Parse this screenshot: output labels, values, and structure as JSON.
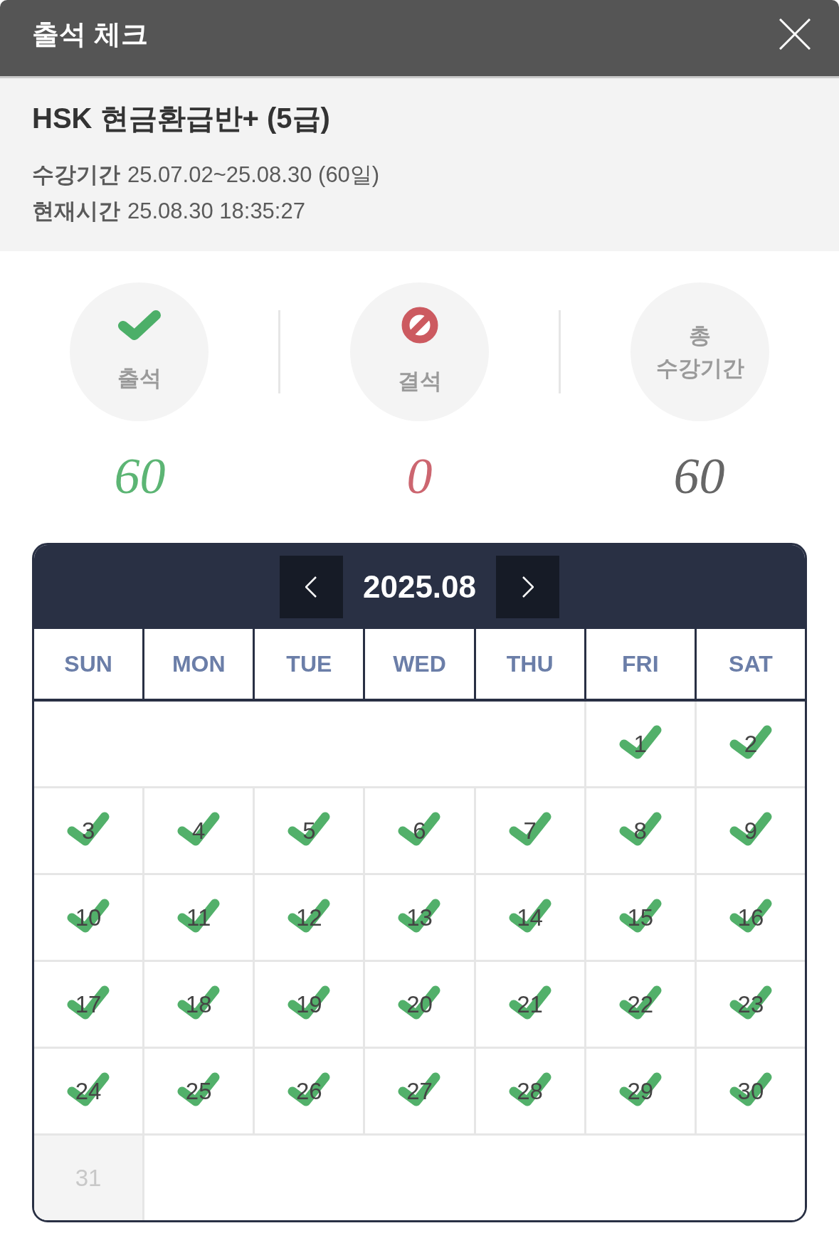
{
  "window": {
    "title": "출석 체크"
  },
  "course": {
    "title": "HSK 현금환급반+ (5급)",
    "details": [
      {
        "label": "수강기간",
        "value": "25.07.02~25.08.30 (60일)"
      },
      {
        "label": "현재시간",
        "value": "25.08.30 18:35:27"
      }
    ]
  },
  "stats": [
    {
      "kind": "present",
      "label": "출석",
      "count": "60",
      "color": "#5cb574"
    },
    {
      "kind": "absent",
      "label": "결석",
      "count": "0",
      "color": "#cc6670"
    },
    {
      "kind": "total",
      "label": "총 수강기간",
      "count": "60",
      "color": "#666666"
    }
  ],
  "calendar": {
    "month": "2025.08",
    "weekdays": [
      "SUN",
      "MON",
      "TUE",
      "WED",
      "THU",
      "FRI",
      "SAT"
    ],
    "weeks": [
      {
        "days": [
          {
            "day": "1",
            "checked": true,
            "disabled": false
          },
          {
            "day": "2",
            "checked": true,
            "disabled": false
          }
        ]
      },
      {
        "days": [
          {
            "day": "3",
            "checked": true,
            "disabled": false
          },
          {
            "day": "4",
            "checked": true,
            "disabled": false
          },
          {
            "day": "5",
            "checked": true,
            "disabled": false
          },
          {
            "day": "6",
            "checked": true,
            "disabled": false
          },
          {
            "day": "7",
            "checked": true,
            "disabled": false
          },
          {
            "day": "8",
            "checked": true,
            "disabled": false
          },
          {
            "day": "9",
            "checked": true,
            "disabled": false
          }
        ]
      },
      {
        "days": [
          {
            "day": "10",
            "checked": true,
            "disabled": false
          },
          {
            "day": "11",
            "checked": true,
            "disabled": false
          },
          {
            "day": "12",
            "checked": true,
            "disabled": false
          },
          {
            "day": "13",
            "checked": true,
            "disabled": false
          },
          {
            "day": "14",
            "checked": true,
            "disabled": false
          },
          {
            "day": "15",
            "checked": true,
            "disabled": false
          },
          {
            "day": "16",
            "checked": true,
            "disabled": false
          }
        ]
      },
      {
        "days": [
          {
            "day": "17",
            "checked": true,
            "disabled": false
          },
          {
            "day": "18",
            "checked": true,
            "disabled": false
          },
          {
            "day": "19",
            "checked": true,
            "disabled": false
          },
          {
            "day": "20",
            "checked": true,
            "disabled": false
          },
          {
            "day": "21",
            "checked": true,
            "disabled": false
          },
          {
            "day": "22",
            "checked": true,
            "disabled": false
          },
          {
            "day": "23",
            "checked": true,
            "disabled": false
          }
        ]
      },
      {
        "days": [
          {
            "day": "24",
            "checked": true,
            "disabled": false
          },
          {
            "day": "25",
            "checked": true,
            "disabled": false
          },
          {
            "day": "26",
            "checked": true,
            "disabled": false
          },
          {
            "day": "27",
            "checked": true,
            "disabled": false
          },
          {
            "day": "28",
            "checked": true,
            "disabled": false
          },
          {
            "day": "29",
            "checked": true,
            "disabled": false
          },
          {
            "day": "30",
            "checked": true,
            "disabled": false
          }
        ]
      },
      {
        "days": [
          {
            "day": "31",
            "checked": false,
            "disabled": true
          }
        ]
      }
    ]
  }
}
